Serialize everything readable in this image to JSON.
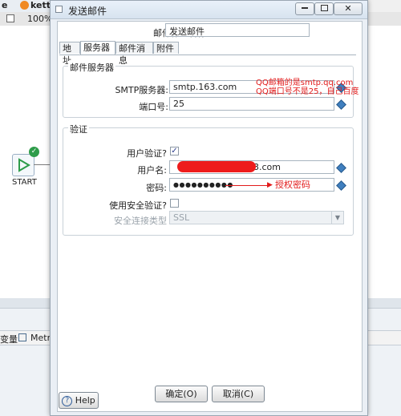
{
  "background": {
    "tab1_label": "e",
    "tab2_label": "kett",
    "tab3_label": "",
    "zoom": "100%",
    "start_label": "START",
    "bottom_tab_vars": "变量",
    "bottom_tab_metrics": "Metr"
  },
  "dialog": {
    "title": "发送邮件",
    "job_name_label": "邮件作业名称:",
    "job_name_value": "发送邮件",
    "tabs": [
      "地址",
      "服务器",
      "邮件消息",
      "附件"
    ],
    "server_group_title": "邮件服务器",
    "smtp_label": "SMTP服务器:",
    "smtp_value": "smtp.163.com",
    "port_label": "端口号:",
    "port_value": "25",
    "auth_group_title": "验证",
    "use_auth_label": "用户验证?",
    "use_auth_checked": "✓",
    "username_label": "用户名:",
    "username_value": "163.com",
    "password_label": "密码:",
    "password_value": "●●●●●●●●●●",
    "secure_auth_label": "使用安全验证?",
    "secure_type_label": "安全连接类型",
    "secure_type_value": "SSL",
    "ok_button": "确定(O)",
    "cancel_button": "取消(C)",
    "help_button": "Help"
  },
  "annotations": {
    "smtp_note_line1": "QQ邮箱的是smtp.qq.com",
    "smtp_note_line2": "QQ端口号不是25，自己百度",
    "password_note": "授权密码"
  },
  "colors": {
    "annotation_red": "#e21b1b",
    "start_green": "#2e9c4a"
  }
}
